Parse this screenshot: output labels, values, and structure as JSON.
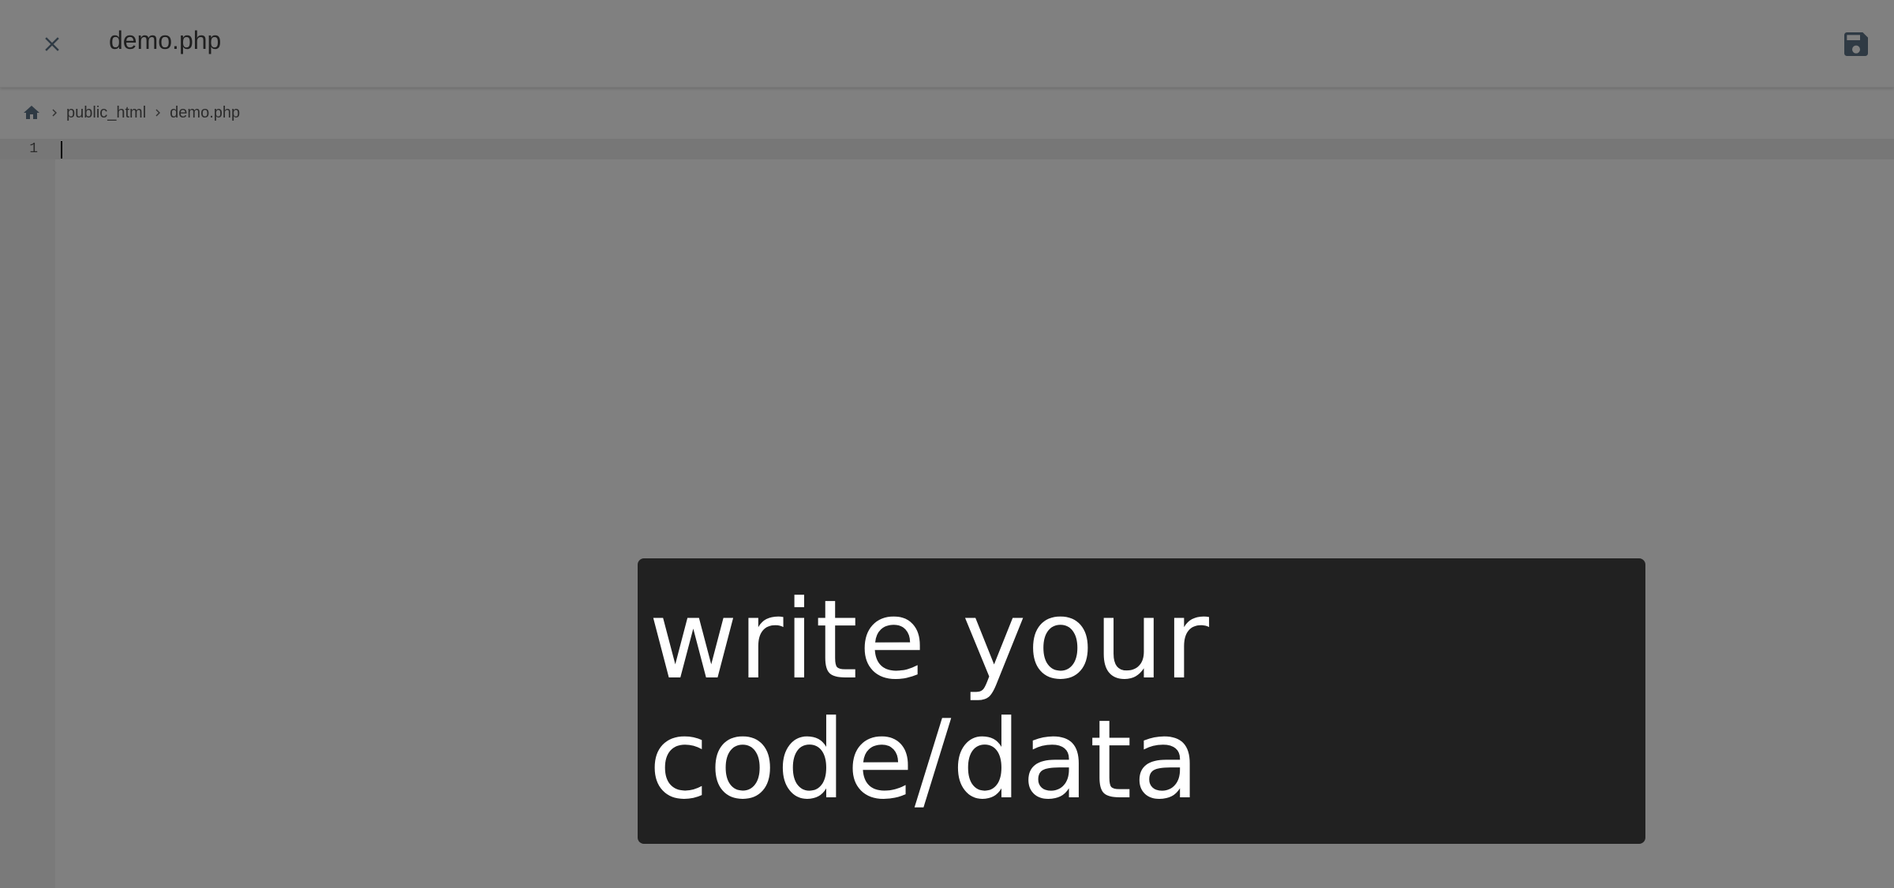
{
  "header": {
    "title": "demo.php",
    "close_icon": "close-icon",
    "save_icon": "save-icon"
  },
  "breadcrumb": {
    "home_icon": "home-icon",
    "items": [
      "public_html",
      "demo.php"
    ]
  },
  "editor": {
    "line_numbers": [
      "1"
    ],
    "content": ""
  },
  "overlay": {
    "lines": [
      "write your",
      "code/data"
    ]
  },
  "colors": {
    "background": "#808080",
    "overlay_bg": "#212121",
    "overlay_text": "#ffffff",
    "icon": "#2f3a44"
  }
}
